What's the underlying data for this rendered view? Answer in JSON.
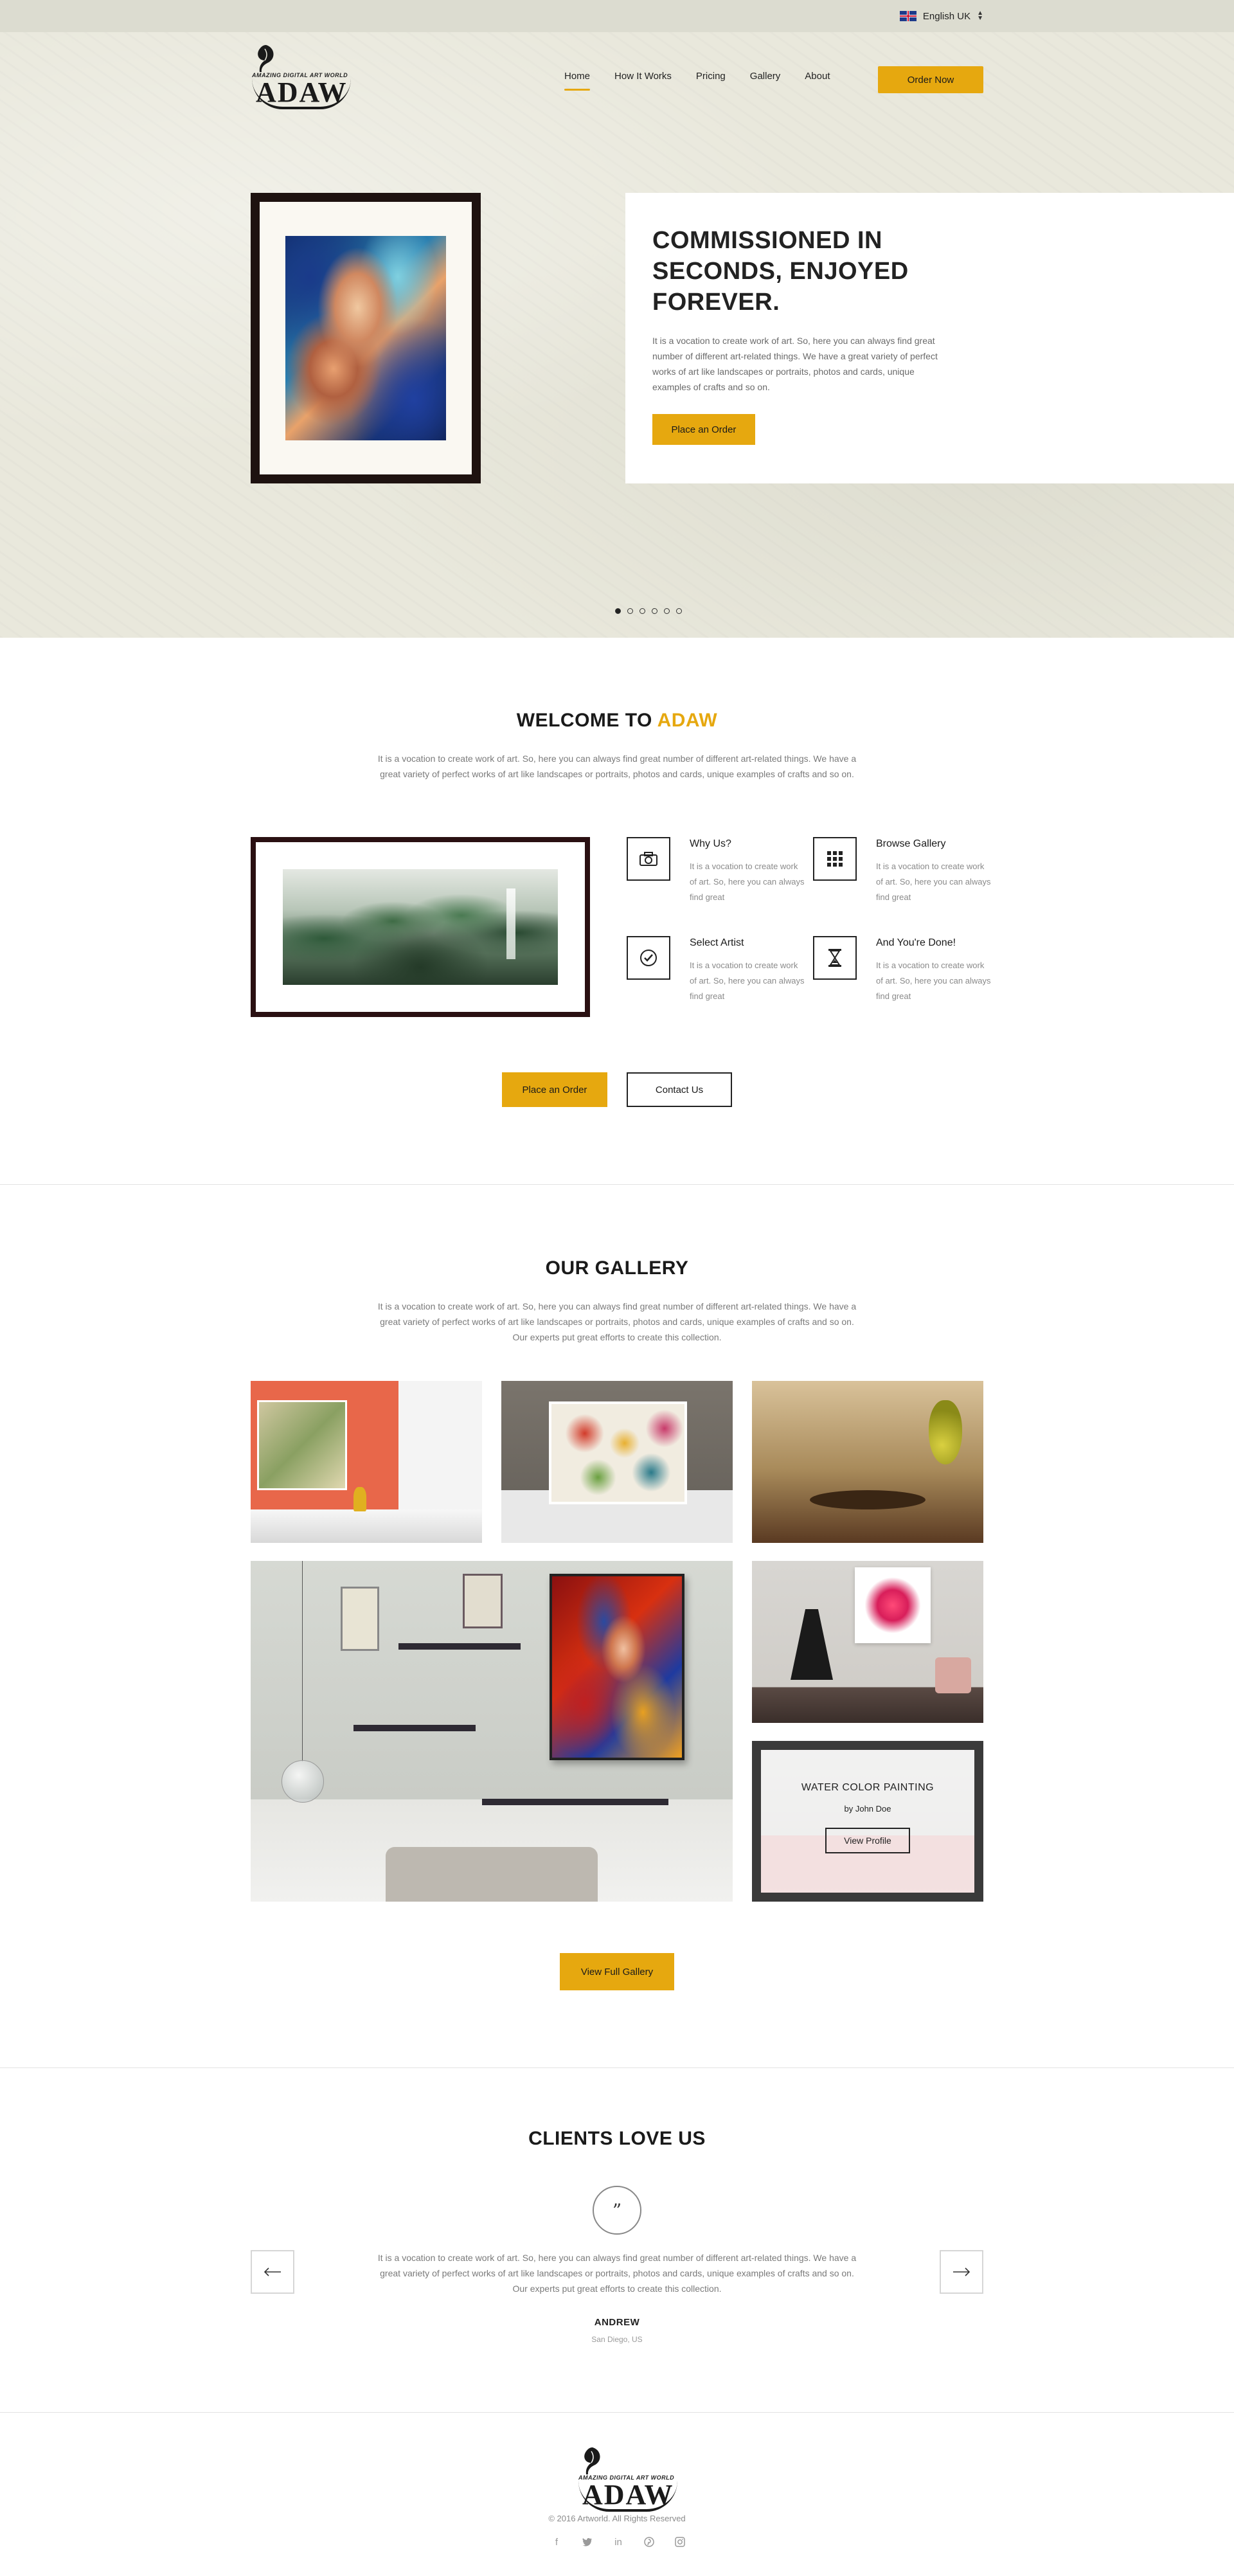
{
  "topbar": {
    "language": "English UK"
  },
  "brand": {
    "tagline": "AMAZING DIGITAL ART WORLD",
    "name": "ADAW"
  },
  "nav": {
    "items": [
      {
        "label": "Home",
        "active": true
      },
      {
        "label": "How It Works",
        "active": false
      },
      {
        "label": "Pricing",
        "active": false
      },
      {
        "label": "Gallery",
        "active": false
      },
      {
        "label": "About",
        "active": false
      }
    ],
    "order_now": "Order Now"
  },
  "hero": {
    "title": "COMMISSIONED IN SECONDS, ENJOYED FOREVER.",
    "text": "It is a vocation to create work of art. So, here you can always find great number of different art-related things. We have a great variety of perfect works of art like landscapes or portraits, photos and cards, unique examples of crafts and so on.",
    "button": "Place an Order",
    "slides": 6,
    "active_slide": 1
  },
  "welcome": {
    "title_prefix": "WELCOME TO",
    "title_accent": "ADAW",
    "text": "It is a vocation to create work of art. So, here you can always find great number of different art-related things. We have a great variety of perfect works of art like landscapes or portraits, photos and cards, unique examples of crafts and so on.",
    "features": [
      {
        "title": "Why Us?",
        "text": "It is a vocation to create work of art. So, here you can always find great",
        "icon": "camera-icon"
      },
      {
        "title": "Browse Gallery",
        "text": "It is a vocation to create work of art. So, here you can always find great",
        "icon": "grid-icon"
      },
      {
        "title": "Select Artist",
        "text": "It is a vocation to create work of art. So, here you can always find great",
        "icon": "check-circle-icon"
      },
      {
        "title": "And You're Done!",
        "text": "It is a vocation to create work of art. So, here you can always find great",
        "icon": "hourglass-icon"
      }
    ],
    "place_order": "Place an Order",
    "contact": "Contact Us"
  },
  "gallery": {
    "title": "OUR GALLERY",
    "text": "It is a vocation to create work of art. So, here you can always find great number of different art-related things. We have a great variety of perfect works of art like landscapes or portraits, photos and cards, unique examples of crafts and so on. Our experts put great efforts to create this collection.",
    "hover_card": {
      "title": "WATER COLOR PAINTING",
      "by": "by John Doe",
      "button": "View Profile"
    },
    "view_full": "View Full Gallery"
  },
  "clients": {
    "title": "CLIENTS LOVE US",
    "quote_mark": "”",
    "quote": "It is a vocation to create work of art. So, here you can always find great number of different art-related things. We have a great variety of perfect works of art like landscapes or portraits, photos and cards, unique examples of crafts and so on. Our experts put great efforts to create this collection.",
    "name": "ANDREW",
    "place": "San Diego, US"
  },
  "footer": {
    "copyright": "© 2016 Artworld. All Rights Reserved",
    "social": [
      "facebook-icon",
      "twitter-icon",
      "linkedin-icon",
      "pinterest-icon",
      "instagram-icon"
    ]
  },
  "colors": {
    "accent": "#e6a80f",
    "topbar": "#dcdcd0",
    "hero_bg": "#e9e8dc",
    "text_dark": "#222222",
    "text_muted": "#7a7a7a"
  }
}
